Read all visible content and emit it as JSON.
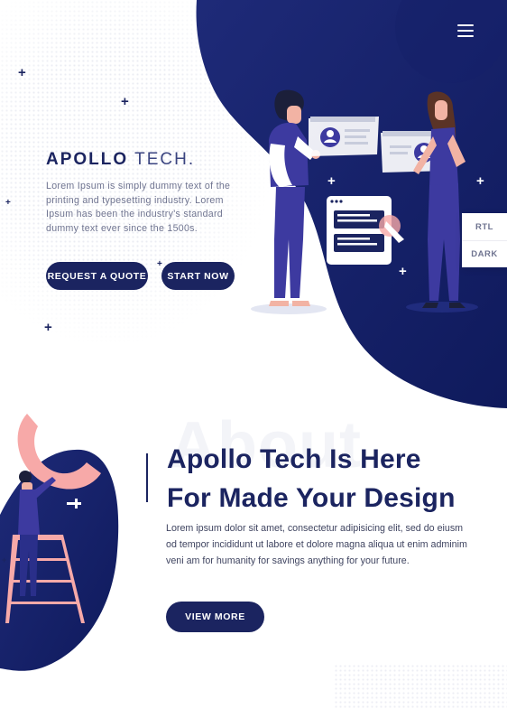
{
  "header": {
    "menu_icon": "hamburger-menu-icon"
  },
  "hero": {
    "brand_bold": "APOLLO",
    "brand_light": "TECH.",
    "description": "Lorem Ipsum is simply dummy text of the printing and typesetting industry. Lorem Ipsum has been the industry's standard dummy text ever since the 1500s.",
    "primary_button": "REQUEST A QUOTE",
    "secondary_button": "START NOW",
    "illustration": "team-working-on-ui-icon"
  },
  "theme_switcher": {
    "rtl_label": "RTL",
    "dark_label": "DARK"
  },
  "about": {
    "watermark": "About",
    "title_line1": "Apollo Tech Is Here",
    "title_line2": "For Made Your Design",
    "description": "Lorem ipsum dolor sit amet, consectetur adipisicing elit, sed do eiusm od tempor incididunt ut labore et dolore magna aliqua ut enim adminim veni am for humanity for savings anything for your future.",
    "button": "VIEW MORE",
    "illustration": "man-on-ladder-icon"
  },
  "colors": {
    "navy": "#1b2460",
    "navy_dark": "#0f1a5c",
    "purple": "#3d3aa0",
    "pink": "#f7a9a8",
    "white": "#ffffff"
  }
}
